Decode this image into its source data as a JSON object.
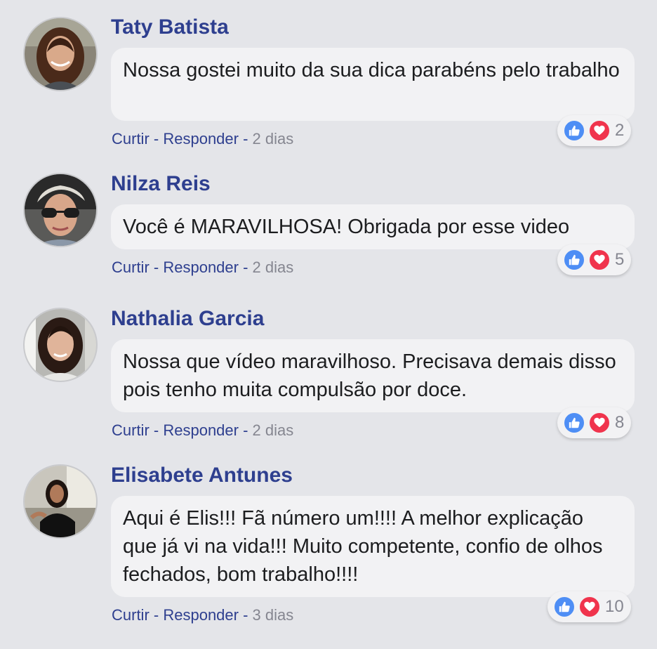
{
  "colors": {
    "background": "#e4e5e9",
    "name": "#2e3f8f",
    "bubble": "#f2f2f4",
    "like": "#4e8ef5",
    "heart": "#f0344d",
    "muted": "#858690"
  },
  "comments": [
    {
      "name": "Taty Batista",
      "text": "Nossa gostei muito da sua dica parabéns pelo trabalho",
      "like_label": "Curtir",
      "reply_label": "Responder",
      "time": "2 dias",
      "reaction_count": "2",
      "icons": [
        "like-icon",
        "heart-icon"
      ]
    },
    {
      "name": "Nilza Reis",
      "text": "Você é MARAVILHOSA! Obrigada por esse video",
      "like_label": "Curtir",
      "reply_label": "Responder",
      "time": "2 dias",
      "reaction_count": "5",
      "icons": [
        "like-icon",
        "heart-icon"
      ]
    },
    {
      "name": "Nathalia Garcia",
      "text": "Nossa que vídeo maravilhoso. Precisava demais disso pois tenho muita compulsão por doce.",
      "like_label": "Curtir",
      "reply_label": "Responder",
      "time": "2 dias",
      "reaction_count": "8",
      "icons": [
        "like-icon",
        "heart-icon"
      ]
    },
    {
      "name": "Elisabete Antunes",
      "text": "Aqui é Elis!!! Fã número um!!!! A melhor explicação que já vi na vida!!! Muito competente, confio de olhos fechados, bom trabalho!!!!",
      "like_label": "Curtir",
      "reply_label": "Responder",
      "time": "3 dias",
      "reaction_count": "10",
      "icons": [
        "like-icon",
        "heart-icon"
      ]
    }
  ]
}
